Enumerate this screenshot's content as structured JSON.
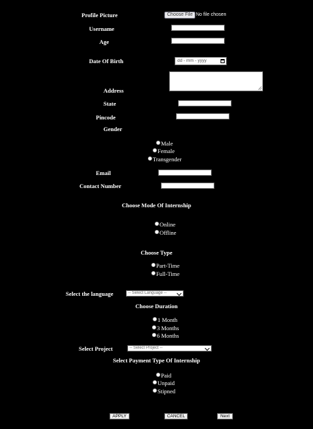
{
  "profile": {
    "label": "Profile Picture",
    "file_button": "Choose File",
    "file_status": "No file chosen"
  },
  "fields": {
    "username_label": "Username",
    "age_label": "Age",
    "dob_label": "Date Of Birth",
    "dob_placeholder": "dd - mm - yyyy",
    "address_label": "Address",
    "state_label": "State",
    "pincode_label": "Pincode",
    "gender_label": "Gender",
    "email_label": "Email",
    "contact_label": "Contact Number"
  },
  "gender_options": [
    "Male",
    "Female",
    "Transgender"
  ],
  "mode": {
    "heading": "Choose Mode Of Internship",
    "options": [
      "Online",
      "Offline"
    ]
  },
  "type": {
    "heading": "Choose Type",
    "options": [
      "Part-Time",
      "Full-Time"
    ]
  },
  "language": {
    "label": "Select the language",
    "selected": "-- Select Language --"
  },
  "duration": {
    "heading": "Choose Duration",
    "options": [
      "1 Month",
      "3 Months",
      "6 Months"
    ]
  },
  "project": {
    "label": "Select Project",
    "selected": "-- Select Project --"
  },
  "payment": {
    "heading": "Select Payment Type Of Internship",
    "options": [
      "Paid",
      "Unpaid",
      "Stipned"
    ]
  },
  "buttons": {
    "apply": "APPLY",
    "cancel": "CANCEL",
    "next": "Next"
  }
}
